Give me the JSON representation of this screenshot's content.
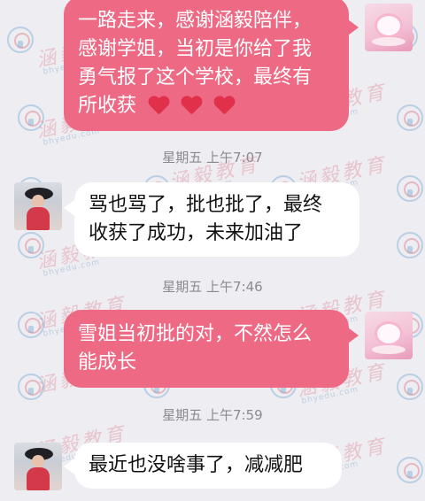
{
  "watermark": {
    "brand": "涵毅教育",
    "domain": "bhyedu.com"
  },
  "messages": [
    {
      "direction": "outgoing",
      "lines": [
        "一路走来，感谢涵毅陪伴，",
        "感谢学姐，当初是你给了我",
        "勇气报了这个学校，最终有",
        "所收获"
      ],
      "emoji": [
        "heart-icon",
        "heart-icon",
        "heart-icon"
      ]
    },
    {
      "type": "timestamp",
      "text": "星期五 上午7:07"
    },
    {
      "direction": "incoming",
      "lines": [
        "骂也骂了，批也批了，最终",
        "收获了成功，未来加油了"
      ]
    },
    {
      "type": "timestamp",
      "text": "星期五 上午7:46"
    },
    {
      "direction": "outgoing",
      "lines": [
        "雪姐当初批的对，不然怎么",
        "能成长"
      ]
    },
    {
      "type": "timestamp",
      "text": "星期五 上午7:59"
    },
    {
      "direction": "incoming",
      "lines": [
        "最近也没啥事了，减减肥"
      ]
    }
  ],
  "colors": {
    "outgoing_bubble": "#ee6a84",
    "incoming_bubble": "#ffffff",
    "background": "#ededf2",
    "timestamp": "#8a8a8f"
  }
}
